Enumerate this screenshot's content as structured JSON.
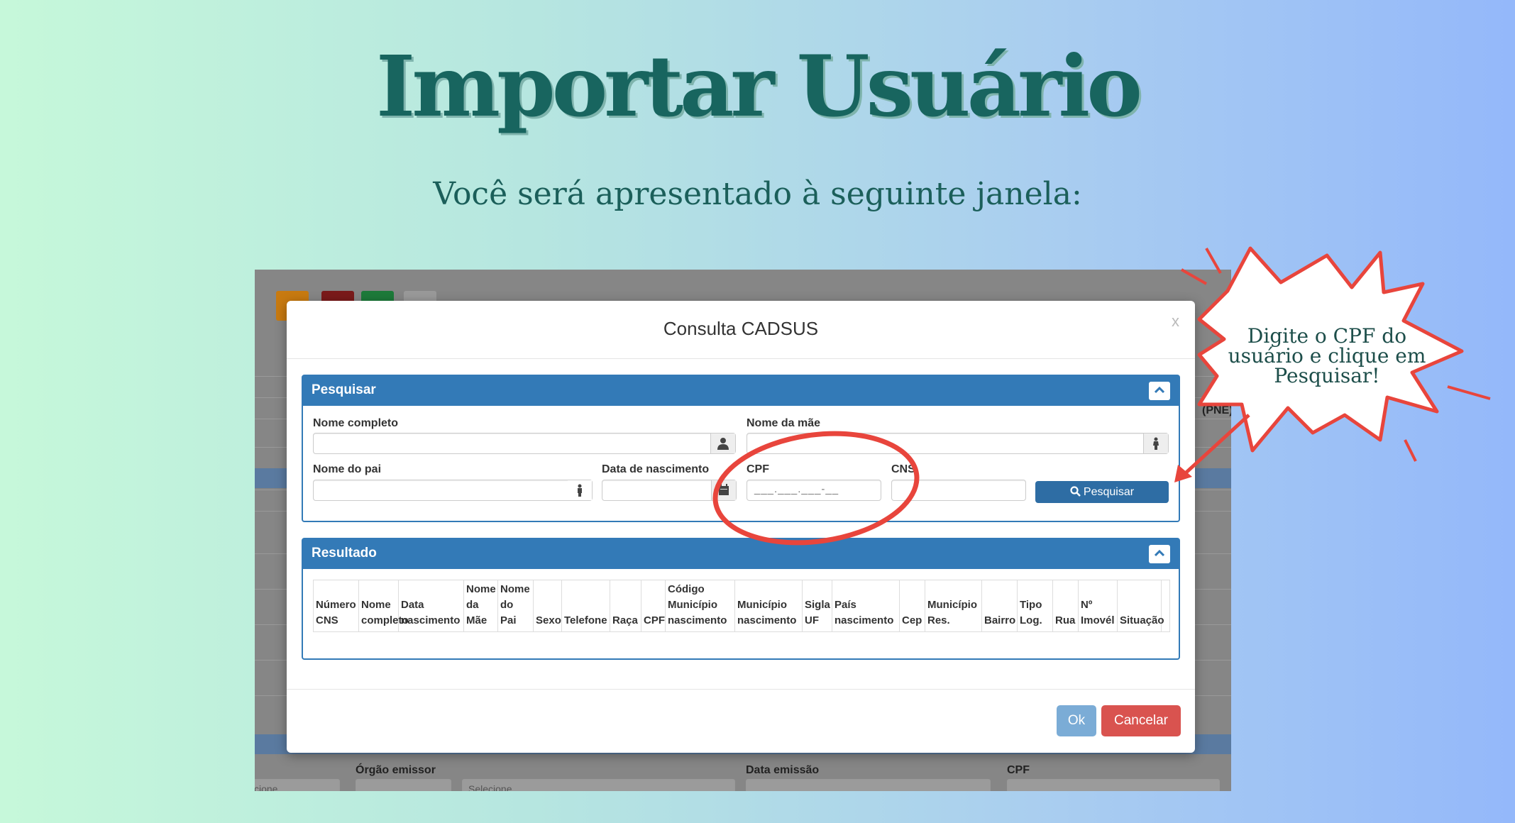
{
  "slide": {
    "title": "Importar Usuário",
    "subtitle": "Você será apresentado à seguinte janela:",
    "callout": "Digite o CPF do usuário e clique em Pesquisar!"
  },
  "background_app": {
    "labels": {
      "pne": "(PNE)",
      "orgao_emissor": "Órgão emissor",
      "data_emissao": "Data emissão",
      "cpf": "CPF"
    },
    "select_placeholder": "Selecione",
    "select_placeholder_partial": "cione"
  },
  "modal": {
    "title": "Consulta CADSUS",
    "close": "x",
    "search_panel": {
      "heading": "Pesquisar",
      "fields": {
        "nome_completo": "Nome completo",
        "nome_mae": "Nome da mãe",
        "nome_pai": "Nome do pai",
        "data_nascimento": "Data de nascimento",
        "cpf": "CPF",
        "cns": "CNS"
      },
      "cpf_mask": "___.___.___-__",
      "search_button": "Pesquisar"
    },
    "result_panel": {
      "heading": "Resultado",
      "columns": [
        [
          "Número",
          "CNS"
        ],
        [
          "Nome",
          "completo"
        ],
        [
          "Data",
          "nascimento"
        ],
        [
          "Nome",
          "da",
          "Mãe"
        ],
        [
          "Nome",
          "do",
          "Pai"
        ],
        [
          "Sexo"
        ],
        [
          "Telefone"
        ],
        [
          "Raça"
        ],
        [
          "CPF"
        ],
        [
          "Código",
          "Município",
          "nascimento"
        ],
        [
          "Município",
          "nascimento"
        ],
        [
          "Sigla",
          "UF"
        ],
        [
          "País",
          "nascimento"
        ],
        [
          "Cep"
        ],
        [
          "Município",
          "Res."
        ],
        [
          "Bairro"
        ],
        [
          "Tipo",
          "Log."
        ],
        [
          "Rua"
        ],
        [
          "Nº",
          "Imovél"
        ],
        [
          "Situação"
        ]
      ]
    },
    "ok_button": "Ok",
    "cancel_button": "Cancelar"
  },
  "colors": {
    "title": "#18655f",
    "panel_blue": "#337ab7",
    "primary_button": "#2e6da4",
    "ok_button": "#7bacd6",
    "cancel_button": "#d9534f",
    "annotation_red": "#e8453c"
  }
}
